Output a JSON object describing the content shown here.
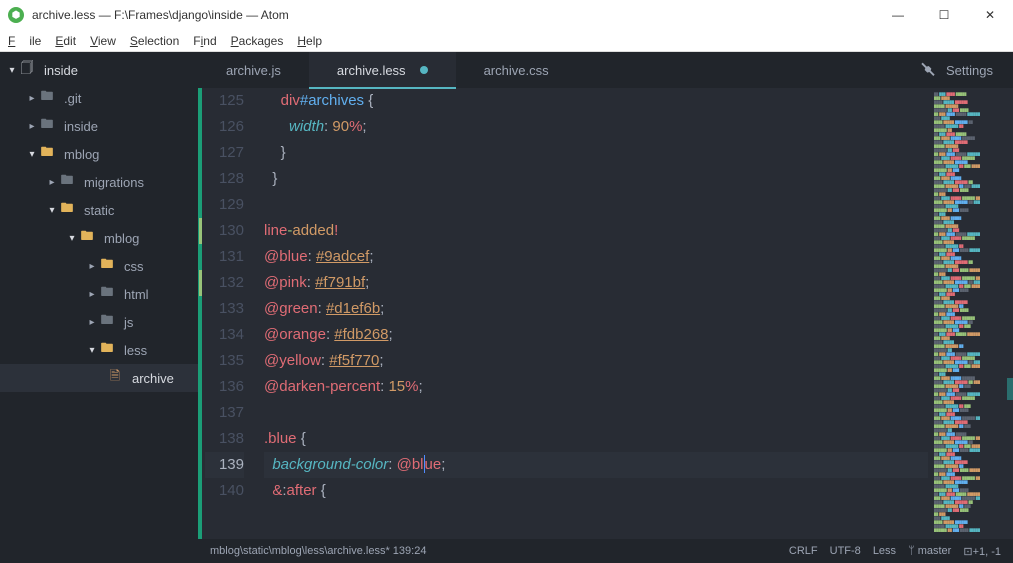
{
  "window": {
    "title": "archive.less — F:\\Frames\\django\\inside — Atom"
  },
  "menu": {
    "file": "File",
    "edit": "Edit",
    "view": "View",
    "selection": "Selection",
    "find": "Find",
    "packages": "Packages",
    "help": "Help"
  },
  "tree": {
    "root": "inside",
    "items": [
      {
        "name": ".git",
        "depth": 1,
        "expanded": false,
        "kind": "folder-dim"
      },
      {
        "name": "inside",
        "depth": 1,
        "expanded": false,
        "kind": "folder"
      },
      {
        "name": "mblog",
        "depth": 1,
        "expanded": true,
        "kind": "folder-open"
      },
      {
        "name": "migrations",
        "depth": 2,
        "expanded": false,
        "kind": "folder"
      },
      {
        "name": "static",
        "depth": 2,
        "expanded": true,
        "kind": "folder-open"
      },
      {
        "name": "mblog",
        "depth": 3,
        "expanded": true,
        "kind": "folder-open"
      },
      {
        "name": "css",
        "depth": 4,
        "expanded": false,
        "kind": "folder-open-s"
      },
      {
        "name": "html",
        "depth": 4,
        "expanded": false,
        "kind": "folder"
      },
      {
        "name": "js",
        "depth": 4,
        "expanded": false,
        "kind": "folder"
      },
      {
        "name": "less",
        "depth": 4,
        "expanded": true,
        "kind": "folder-open"
      },
      {
        "name": "archive",
        "depth": 5,
        "expanded": null,
        "kind": "file",
        "active": true
      }
    ]
  },
  "tabs": [
    {
      "label": "archive.js",
      "active": false,
      "modified": false
    },
    {
      "label": "archive.less",
      "active": true,
      "modified": true
    },
    {
      "label": "archive.css",
      "active": false,
      "modified": false
    }
  ],
  "settings_label": "Settings",
  "code": {
    "first_line": 125,
    "cursor_line": 139,
    "lines": [
      {
        "n": 125,
        "indent": 2,
        "tokens": [
          [
            "sel",
            "div"
          ],
          [
            "id",
            "#archives"
          ],
          [
            "punc",
            " {"
          ]
        ]
      },
      {
        "n": 126,
        "indent": 3,
        "tokens": [
          [
            "prop",
            "width"
          ],
          [
            "punc",
            ": "
          ],
          [
            "num",
            "90"
          ],
          [
            "unit",
            "%"
          ],
          [
            "punc",
            ";"
          ]
        ]
      },
      {
        "n": 127,
        "indent": 2,
        "tokens": [
          [
            "punc",
            "}"
          ]
        ]
      },
      {
        "n": 128,
        "indent": 1,
        "tokens": [
          [
            "punc",
            "}"
          ]
        ]
      },
      {
        "n": 129,
        "indent": 0,
        "tokens": []
      },
      {
        "n": 130,
        "indent": 0,
        "add": true,
        "tokens": [
          [
            "added",
            "line"
          ],
          [
            "added2",
            "-"
          ],
          [
            "added3",
            "added"
          ],
          [
            "added",
            "!"
          ]
        ]
      },
      {
        "n": 131,
        "indent": 0,
        "tokens": [
          [
            "at",
            "@blue"
          ],
          [
            "punc",
            ": "
          ],
          [
            "hex",
            "#9adcef"
          ],
          [
            "punc",
            ";"
          ]
        ]
      },
      {
        "n": 132,
        "indent": 0,
        "add": true,
        "tokens": [
          [
            "at",
            "@pink"
          ],
          [
            "punc",
            ": "
          ],
          [
            "hex",
            "#f791bf"
          ],
          [
            "punc",
            ";"
          ]
        ]
      },
      {
        "n": 133,
        "indent": 0,
        "tokens": [
          [
            "at",
            "@green"
          ],
          [
            "punc",
            ": "
          ],
          [
            "hex",
            "#d1ef6b"
          ],
          [
            "punc",
            ";"
          ]
        ]
      },
      {
        "n": 134,
        "indent": 0,
        "tokens": [
          [
            "at",
            "@orange"
          ],
          [
            "punc",
            ": "
          ],
          [
            "hex",
            "#fdb268"
          ],
          [
            "punc",
            ";"
          ]
        ]
      },
      {
        "n": 135,
        "indent": 0,
        "tokens": [
          [
            "at",
            "@yellow"
          ],
          [
            "punc",
            ": "
          ],
          [
            "hex",
            "#f5f770"
          ],
          [
            "punc",
            ";"
          ]
        ]
      },
      {
        "n": 136,
        "indent": 0,
        "tokens": [
          [
            "at",
            "@darken-percent"
          ],
          [
            "punc",
            ": "
          ],
          [
            "num",
            "15"
          ],
          [
            "unit",
            "%"
          ],
          [
            "punc",
            ";"
          ]
        ]
      },
      {
        "n": 137,
        "indent": 0,
        "tokens": []
      },
      {
        "n": 138,
        "indent": 0,
        "tokens": [
          [
            "sel",
            ".blue"
          ],
          [
            "punc",
            " {"
          ]
        ]
      },
      {
        "n": 139,
        "indent": 1,
        "cursor": true,
        "tokens": [
          [
            "prop",
            "background-color"
          ],
          [
            "punc",
            ": "
          ],
          [
            "at",
            "@bl"
          ],
          [
            "caret",
            ""
          ],
          [
            "at",
            "ue"
          ],
          [
            "punc",
            ";"
          ]
        ]
      },
      {
        "n": 140,
        "indent": 1,
        "tokens": [
          [
            "sel",
            "&"
          ],
          [
            "punc",
            ":"
          ],
          [
            "sel",
            "after"
          ],
          [
            "punc",
            " {"
          ]
        ]
      }
    ]
  },
  "status": {
    "path": "mblog\\static\\mblog\\less\\archive.less*  139:24",
    "eol": "CRLF",
    "enc": "UTF-8",
    "lang": "Less",
    "branch": "master",
    "diff": "+1, -1"
  }
}
